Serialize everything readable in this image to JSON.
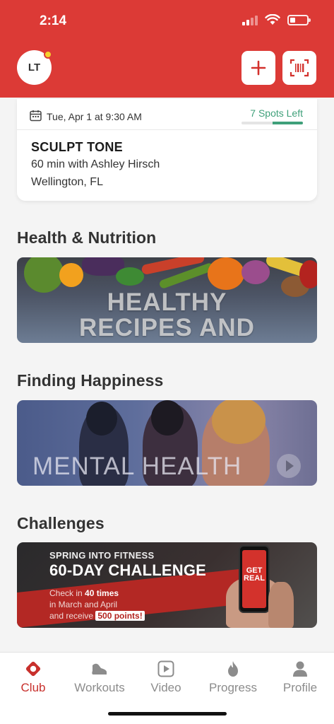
{
  "status_bar": {
    "time": "2:14"
  },
  "header": {
    "avatar_initials": "LT",
    "add_icon": "plus-icon",
    "scan_icon": "barcode-scan-icon",
    "brand_color": "#dc3a36"
  },
  "class_card": {
    "date": "Tue, Apr 1 at 9:30 AM",
    "spots_left": "7 Spots Left",
    "spots_fraction": 0.5,
    "name": "SCULPT TONE",
    "detail": "60 min with Ashley  Hirsch",
    "location": "Wellington, FL"
  },
  "sections": {
    "health_title": "Health & Nutrition",
    "health_banner_text": "HEALTHY RECIPES AND NUTRITION",
    "happiness_title": "Finding Happiness",
    "happiness_banner_text": "MENTAL HEALTH",
    "challenges_title": "Challenges",
    "challenge": {
      "subtitle": "SPRING INTO FITNESS",
      "title": "60-DAY CHALLENGE",
      "line1_prefix": "Check in ",
      "line1_bold": "40 times",
      "line2": "in March and April",
      "line3_prefix": "and receive ",
      "line3_badge": "500 points!",
      "phone_text": "GET REAL"
    }
  },
  "tabbar": {
    "items": [
      {
        "label": "Club",
        "icon": "club-icon",
        "active": true
      },
      {
        "label": "Workouts",
        "icon": "shoe-icon",
        "active": false
      },
      {
        "label": "Video",
        "icon": "play-square-icon",
        "active": false
      },
      {
        "label": "Progress",
        "icon": "flame-icon",
        "active": false
      },
      {
        "label": "Profile",
        "icon": "person-icon",
        "active": false
      }
    ],
    "active_color": "#c8302c",
    "inactive_color": "#8c8c8c"
  }
}
